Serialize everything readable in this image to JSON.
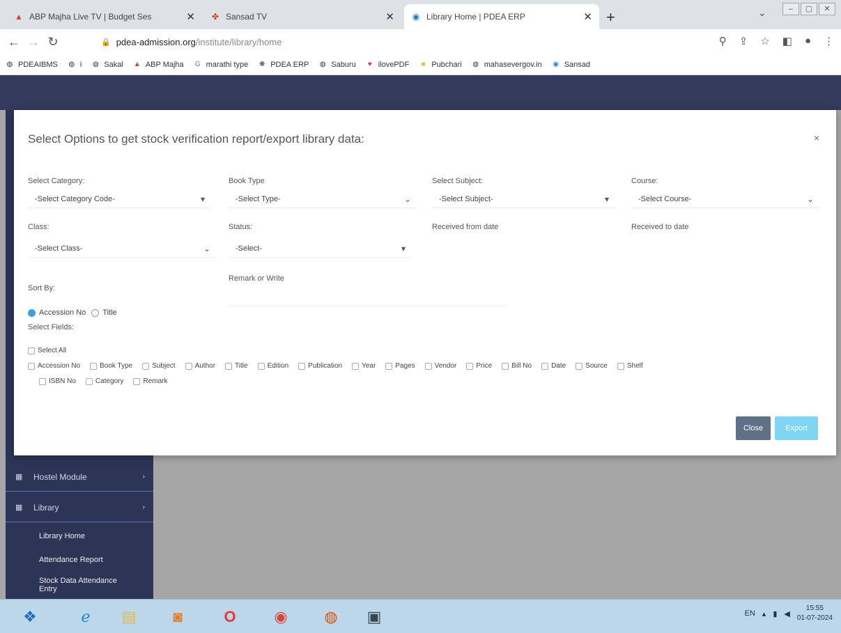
{
  "browser": {
    "tabs": [
      {
        "title": "ABP Majha Live TV | Budget Ses",
        "favicon": "abp-logo-icon"
      },
      {
        "title": "Sansad TV",
        "favicon": "sansad-logo-icon"
      },
      {
        "title": "Library Home | PDEA ERP",
        "favicon": "site-logo-icon"
      }
    ],
    "new_tab": "+",
    "url": "pdea-admission.org",
    "url_path": "/institute/library/home",
    "bookmarks": [
      "PDEAIBMS",
      "i",
      "Sakal",
      "ABP Majha",
      "marathi type",
      "PDEA ERP",
      "Saburu",
      "ilovePDF",
      "Pubchari",
      "mahasevergov.in",
      "Sansad"
    ]
  },
  "sidebar": {
    "items": [
      {
        "label": "Hostel Module"
      },
      {
        "label": "Library"
      }
    ],
    "sub_items": [
      "Library Home",
      "Attendance Report",
      "Stock Data Attendance Entry"
    ]
  },
  "modal": {
    "title": "Select Options to get stock verification report/export library data:",
    "close": "×",
    "fields": {
      "category": {
        "label": "Select Category:",
        "value": "-Select Category Code-"
      },
      "book_type": {
        "label": "Book Type",
        "value": "-Select Type-"
      },
      "subject": {
        "label": "Select Subject:",
        "value": "-Select Subject-"
      },
      "course": {
        "label": "Course:",
        "value": "-Select Course-"
      },
      "class": {
        "label": "Class:",
        "value": "-Select Class-"
      },
      "status": {
        "label": "Status:",
        "value": "-Select-"
      },
      "received_from": {
        "label": "Received from date"
      },
      "received_to": {
        "label": "Received to date"
      },
      "remark": {
        "label": "Remark or Write"
      }
    },
    "sort_by": {
      "label": "Sort By:",
      "options": [
        "Accession No",
        "Title"
      ],
      "selected": "Accession No"
    },
    "select_fields": {
      "label": "Select Fields:",
      "select_all": "Select All",
      "row1": [
        "Accession No",
        "Book Type",
        "Subject",
        "Author",
        "Title",
        "Edition",
        "Publication",
        "Year",
        "Pages",
        "Vendor",
        "Price",
        "Bill No",
        "Date",
        "Source",
        "Shelf"
      ],
      "row2": [
        "ISBN No",
        "Category",
        "Remark"
      ]
    },
    "buttons": {
      "close": "Close",
      "export": "Export"
    }
  },
  "taskbar": {
    "time": "15:55",
    "date": "01-07-2024",
    "lang": "EN"
  }
}
